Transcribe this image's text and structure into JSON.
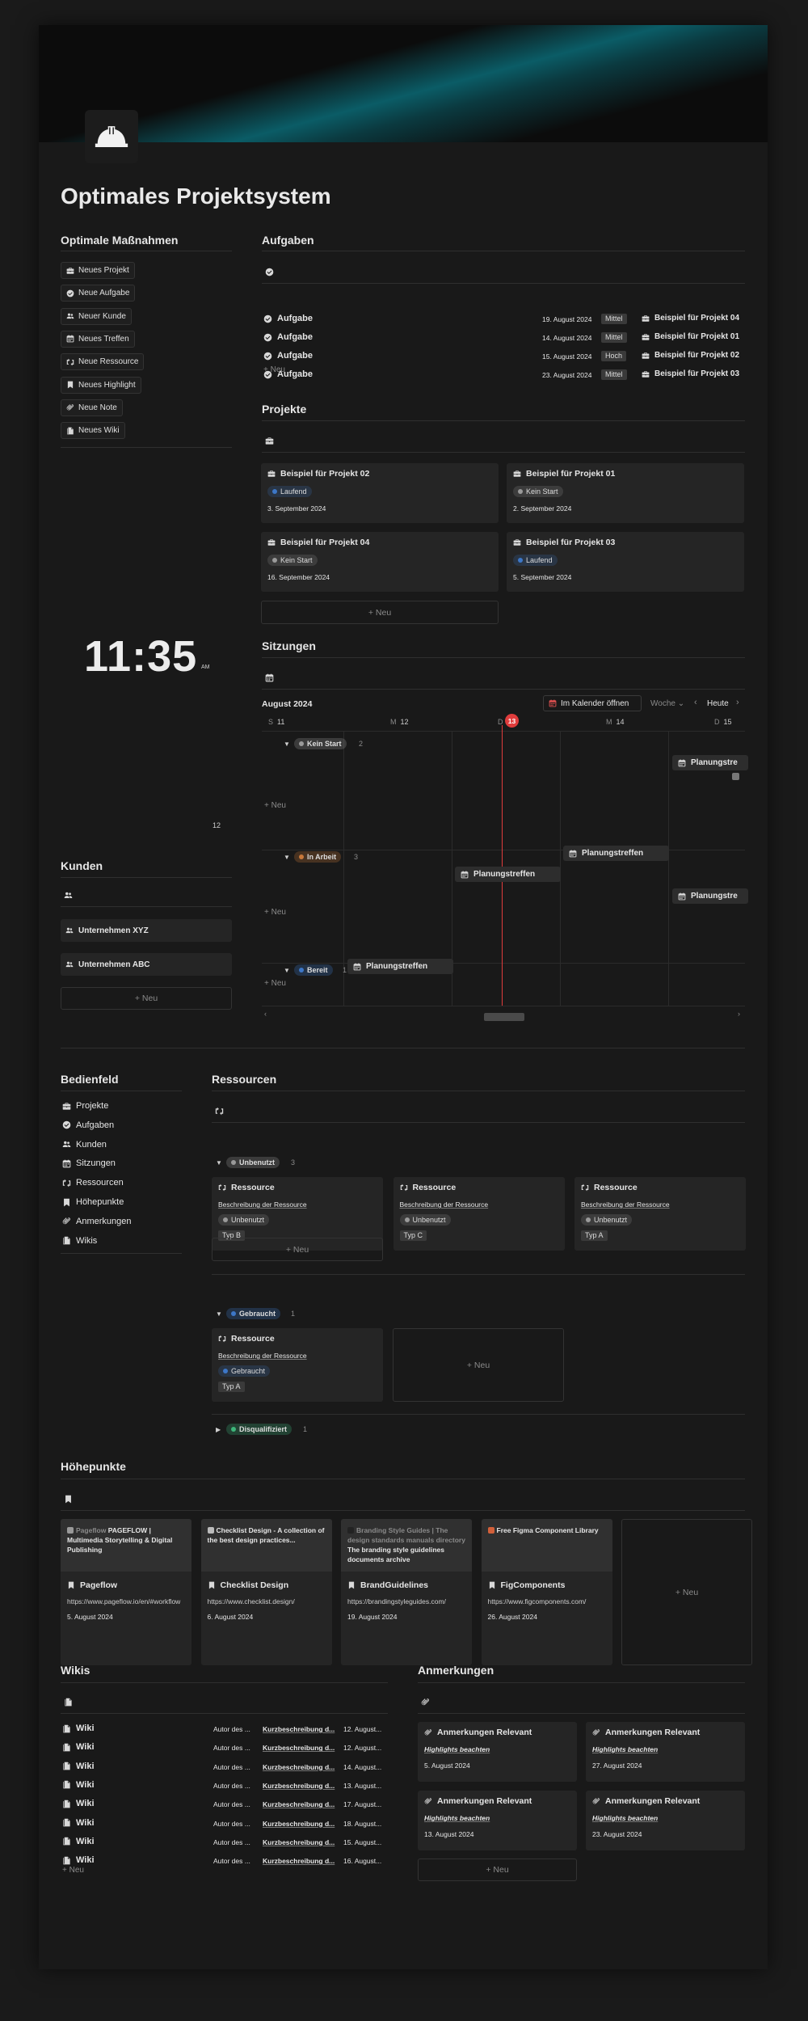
{
  "page": {
    "title": "Optimales Projektsystem"
  },
  "massnahmen": {
    "heading": "Optimale Maßnahmen",
    "buttons": [
      {
        "label": "Neues Projekt",
        "icon": "briefcase-icon"
      },
      {
        "label": "Neue Aufgabe",
        "icon": "check-circle-icon"
      },
      {
        "label": "Neuer Kunde",
        "icon": "people-icon"
      },
      {
        "label": "Neues Treffen",
        "icon": "calendar-icon"
      },
      {
        "label": "Neue Ressource",
        "icon": "repeat-icon"
      },
      {
        "label": "Neues Highlight",
        "icon": "bookmark-icon"
      },
      {
        "label": "Neue Note",
        "icon": "paperclip-icon"
      },
      {
        "label": "Neues Wiki",
        "icon": "document-icon"
      }
    ]
  },
  "aufgaben": {
    "heading": "Aufgaben",
    "rows": [
      {
        "name": "Aufgabe",
        "date": "19. August 2024",
        "prio": "Mittel",
        "project": "Beispiel für Projekt 04"
      },
      {
        "name": "Aufgabe",
        "date": "14. August 2024",
        "prio": "Mittel",
        "project": "Beispiel für Projekt 01"
      },
      {
        "name": "Aufgabe",
        "date": "15. August 2024",
        "prio": "Hoch",
        "project": "Beispiel für Projekt 02"
      },
      {
        "name": "Aufgabe",
        "date": "23. August 2024",
        "prio": "Mittel",
        "project": "Beispiel für Projekt 03"
      }
    ],
    "new_label": "Neu"
  },
  "projekte": {
    "heading": "Projekte",
    "cards": [
      {
        "title": "Beispiel für Projekt 02",
        "status": "Laufend",
        "date": "3. September 2024"
      },
      {
        "title": "Beispiel für Projekt 01",
        "status": "Kein Start",
        "date": "2. September 2024"
      },
      {
        "title": "Beispiel für Projekt 04",
        "status": "Kein Start",
        "date": "16. September 2024"
      },
      {
        "title": "Beispiel für Projekt 03",
        "status": "Laufend",
        "date": "5. September 2024"
      }
    ],
    "new_label": "Neu"
  },
  "clock": {
    "time": "11:35",
    "ampm": "AM",
    "day": "12"
  },
  "kunden": {
    "heading": "Kunden",
    "items": [
      "Unternehmen XYZ",
      "Unternehmen ABC"
    ],
    "new_label": "Neu"
  },
  "sitzungen": {
    "heading": "Sitzungen",
    "month": "August 2024",
    "open_cal": "Im Kalender öffnen",
    "view": "Woche",
    "today": "Heute",
    "days": [
      {
        "l": "S",
        "n": "11"
      },
      {
        "l": "M",
        "n": "12"
      },
      {
        "l": "D",
        "n": "13"
      },
      {
        "l": "M",
        "n": "14"
      },
      {
        "l": "D",
        "n": "15"
      }
    ],
    "groups": [
      {
        "label": "Kein Start",
        "count": "2"
      },
      {
        "label": "In Arbeit",
        "count": "3"
      },
      {
        "label": "Bereit",
        "count": "1"
      }
    ],
    "event": "Planungstreffen",
    "event_cut": "Planungstre",
    "new_label": "Neu"
  },
  "bedienfeld": {
    "heading": "Bedienfeld",
    "items": [
      {
        "label": "Projekte",
        "icon": "briefcase-icon"
      },
      {
        "label": "Aufgaben",
        "icon": "check-circle-icon"
      },
      {
        "label": "Kunden",
        "icon": "people-icon"
      },
      {
        "label": "Sitzungen",
        "icon": "calendar-icon"
      },
      {
        "label": "Ressourcen",
        "icon": "repeat-icon"
      },
      {
        "label": "Höhepunkte",
        "icon": "bookmark-icon"
      },
      {
        "label": "Anmerkungen",
        "icon": "paperclip-icon"
      },
      {
        "label": "Wikis",
        "icon": "document-icon"
      }
    ]
  },
  "ressourcen": {
    "heading": "Ressourcen",
    "title": "Ressource",
    "desc": "Beschreibung der Ressource",
    "groups": [
      {
        "label": "Unbenutzt",
        "count": "3"
      },
      {
        "label": "Gebraucht",
        "count": "1"
      },
      {
        "label": "Disqualifiziert",
        "count": "1"
      }
    ],
    "unbenutzt_types": [
      "Typ B",
      "Typ C",
      "Typ A"
    ],
    "gebraucht_type": "Typ A",
    "new_label": "Neu"
  },
  "hoehepunkte": {
    "heading": "Höhepunkte",
    "cards": [
      {
        "brand": "Pageflow",
        "preview": "PAGEFLOW | Multimedia Storytelling & Digital Publishing",
        "title": "Pageflow",
        "url": "https://www.pageflow.io/en/#workflow",
        "date": "5. August 2024"
      },
      {
        "brand": "",
        "preview": "Checklist Design - A collection of the best design practices...",
        "title": "Checklist Design",
        "url": "https://www.checklist.design/",
        "date": "6. August 2024"
      },
      {
        "brand": "Branding Style Guides | The design standards manuals directory",
        "preview": "The branding style guidelines documents archive",
        "title": "BrandGuidelines",
        "url": "https://brandingstyleguides.com/",
        "date": "19. August 2024"
      },
      {
        "brand": "",
        "preview": "Free Figma Component Library",
        "title": "FigComponents",
        "url": "https://www.figcomponents.com/",
        "date": "26. August 2024"
      }
    ],
    "new_label": "Neu"
  },
  "wikis": {
    "heading": "Wikis",
    "name": "Wiki",
    "author": "Autor des ...",
    "desc": "Kurzbeschreibung d...",
    "dates": [
      "12. August...",
      "12. August...",
      "14. August...",
      "13. August...",
      "17. August...",
      "18. August...",
      "15. August...",
      "16. August..."
    ],
    "new_label": "Neu"
  },
  "anmerkungen": {
    "heading": "Anmerkungen",
    "title": "Anmerkungen Relevant",
    "sub": "Highlights beachten",
    "dates": [
      "5. August 2024",
      "27. August 2024",
      "13. August 2024",
      "23. August 2024"
    ],
    "new_label": "Neu"
  },
  "colors": {
    "laufend": "#3d77c7",
    "kein_start": "#9a9a9a",
    "in_arbeit": "#c8783a",
    "bereit": "#3d77c7",
    "gebraucht": "#3d77c7",
    "unbenutzt": "#9a9a9a",
    "today": "#e03c3c"
  }
}
